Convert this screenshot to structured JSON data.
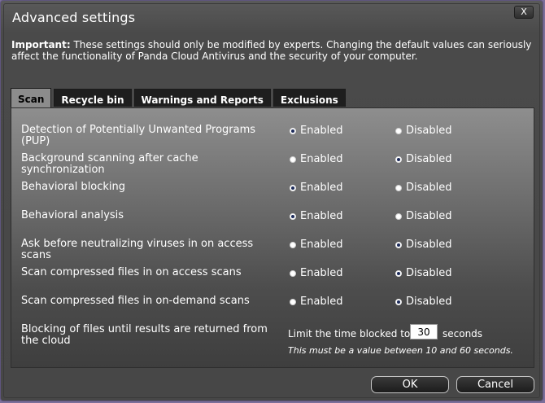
{
  "window": {
    "title": "Advanced settings",
    "close_label": "X"
  },
  "notice": {
    "bold": "Important:",
    "text": " These settings should only be modified by experts. Changing the default values can seriously affect the functionality of Panda Cloud Antivirus and the security of your computer."
  },
  "tabs": [
    {
      "label": "Scan",
      "active": true
    },
    {
      "label": "Recycle bin",
      "active": false
    },
    {
      "label": "Warnings and Reports",
      "active": false
    },
    {
      "label": "Exclusions",
      "active": false
    }
  ],
  "options": {
    "enabled_label": "Enabled",
    "disabled_label": "Disabled"
  },
  "settings": [
    {
      "label": "Detection of Potentially Unwanted Programs (PUP)",
      "value": "enabled"
    },
    {
      "label": "Background scanning after cache synchronization",
      "value": "disabled"
    },
    {
      "label": "Behavioral blocking",
      "value": "enabled"
    },
    {
      "label": "Behavioral analysis",
      "value": "enabled"
    },
    {
      "label": "Ask before neutralizing viruses in on access scans",
      "value": "disabled"
    },
    {
      "label": "Scan compressed files in on access scans",
      "value": "disabled"
    },
    {
      "label": "Scan compressed files in on-demand scans",
      "value": "disabled"
    }
  ],
  "blocking": {
    "label": "Blocking of files until results are returned from the cloud",
    "limit_prefix": "Limit the time blocked to",
    "value": "30",
    "suffix": "seconds",
    "hint": "This must be a value between 10 and 60 seconds."
  },
  "buttons": {
    "ok": "OK",
    "cancel": "Cancel"
  }
}
